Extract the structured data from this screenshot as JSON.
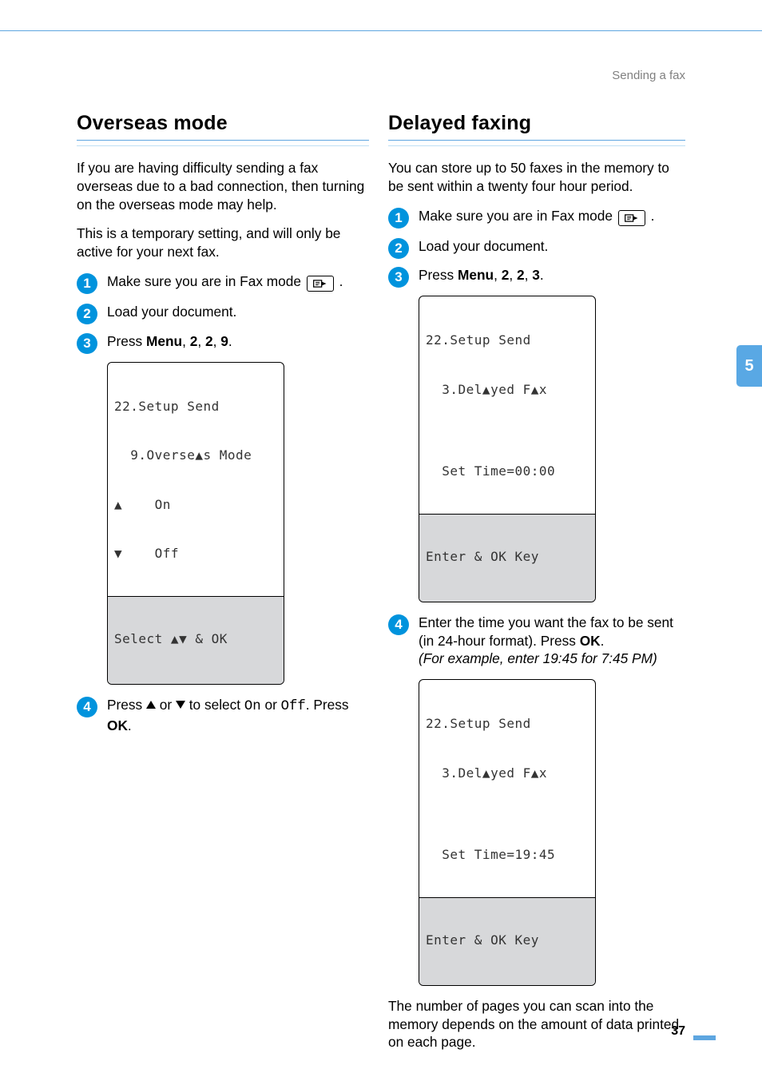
{
  "header": {
    "running_title": "Sending a fax"
  },
  "side_tab": "5",
  "page_number": "37",
  "left": {
    "title": "Overseas mode",
    "para1": "If you are having difficulty sending a fax overseas due to a bad connection, then turning on the overseas mode may help.",
    "para2": "This is a temporary setting, and will only be active for your next fax.",
    "steps": {
      "s1": "Make sure you are in Fax mode ",
      "s1_end": ".",
      "s2": "Load your document.",
      "s3_a": "Press ",
      "s3_b": "Menu",
      "s3_c": ", ",
      "s3_d": "2",
      "s3_e": ", ",
      "s3_f": "2",
      "s3_g": ", ",
      "s3_h": "9",
      "s3_i": ".",
      "s4_a": "Press ",
      "s4_b": " or ",
      "s4_c": " to select ",
      "s4_on": "On",
      "s4_d": " or ",
      "s4_off": "Off",
      "s4_e": ". Press ",
      "s4_ok": "OK",
      "s4_f": "."
    },
    "lcd1": {
      "l1": "22.Setup Send",
      "l2": "  9.Overseas Mode",
      "l3": "a    On",
      "l4": "b    Off",
      "bot": "Select ab & OK"
    }
  },
  "right": {
    "title": "Delayed faxing",
    "para1": "You can store up to 50 faxes in the memory to be sent within a twenty four hour period.",
    "steps": {
      "s1": "Make sure you are in Fax mode ",
      "s1_end": ".",
      "s2": "Load your document.",
      "s3_a": "Press ",
      "s3_b": "Menu",
      "s3_c": ", ",
      "s3_d": "2",
      "s3_e": ", ",
      "s3_f": "2",
      "s3_g": ", ",
      "s3_h": "3",
      "s3_i": ".",
      "s4_a": "Enter the time you want the fax to be sent (in 24-hour format). Press ",
      "s4_ok": "OK",
      "s4_b": ".",
      "s4_ex": "(For example, enter 19:45 for 7:45 PM)"
    },
    "lcd1": {
      "l1": "22.Setup Send",
      "l2": "  3.Delayed Fax",
      "l3": "",
      "l4": "  Set Time=00:00",
      "bot": "Enter & OK Key"
    },
    "lcd2": {
      "l1": "22.Setup Send",
      "l2": "  3.Delayed Fax",
      "l3": "",
      "l4": "  Set Time=19:45",
      "bot": "Enter & OK Key"
    },
    "para2": "The number of pages you can scan into the memory depends on the amount of data printed on each page."
  }
}
